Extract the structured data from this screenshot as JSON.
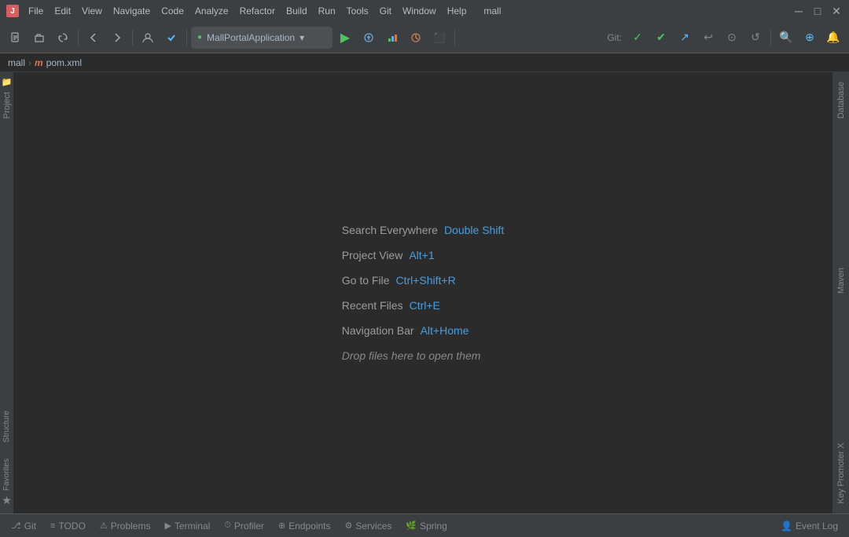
{
  "titlebar": {
    "app_name": "mall",
    "window_controls": {
      "minimize": "─",
      "restore": "□",
      "close": "✕"
    }
  },
  "menubar": {
    "items": [
      "File",
      "Edit",
      "View",
      "Navigate",
      "Code",
      "Analyze",
      "Refactor",
      "Build",
      "Run",
      "Tools",
      "Git",
      "Window",
      "Help",
      "mall"
    ]
  },
  "toolbar": {
    "run_config_icon": "🟢",
    "run_config_label": "MallPortalApplication",
    "run_config_arrow": "▾",
    "git_label": "Git:"
  },
  "breadcrumb": {
    "project": "mall",
    "separator": "›",
    "file_icon": "m",
    "file": "pom.xml"
  },
  "editor": {
    "hints": [
      {
        "label": "Search Everywhere",
        "shortcut": "Double Shift"
      },
      {
        "label": "Project View",
        "shortcut": "Alt+1"
      },
      {
        "label": "Go to File",
        "shortcut": "Ctrl+Shift+R"
      },
      {
        "label": "Recent Files",
        "shortcut": "Ctrl+E"
      },
      {
        "label": "Navigation Bar",
        "shortcut": "Alt+Home"
      }
    ],
    "drop_hint": "Drop files here to open them"
  },
  "right_sidebar": {
    "items": [
      "Database",
      "Maven",
      "Key Promoter X"
    ]
  },
  "left_outer": {
    "structure_label": "Structure",
    "favorites_label": "Favorites",
    "favorites_icon": "★"
  },
  "bottom_tabs": [
    {
      "icon": "⎇",
      "label": "Git"
    },
    {
      "icon": "≡",
      "label": "TODO"
    },
    {
      "icon": "⚠",
      "label": "Problems"
    },
    {
      "icon": "▶",
      "label": "Terminal"
    },
    {
      "icon": "⏱",
      "label": "Profiler"
    },
    {
      "icon": "⊕",
      "label": "Endpoints"
    },
    {
      "icon": "⚙",
      "label": "Services"
    },
    {
      "icon": "🌿",
      "label": "Spring"
    }
  ],
  "bottom_right": {
    "icon": "👤",
    "label": "Event Log"
  }
}
